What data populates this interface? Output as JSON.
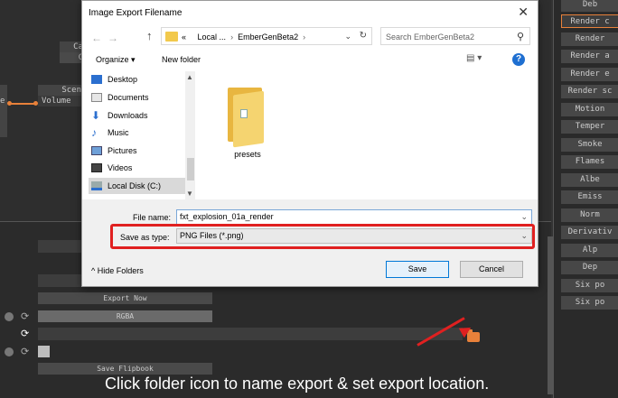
{
  "background": {
    "nodes": [
      {
        "title": "Ca",
        "body": "C"
      },
      {
        "title": "Scen",
        "body": "Volume"
      }
    ],
    "left_cut_text": "e",
    "export_now_label": "Export Now",
    "format_label": "RGBA",
    "save_flipbook_label": "Save Flipbook",
    "right_panel": [
      "Deb",
      "Render c",
      "Render",
      "Render a",
      "Render e",
      "Render sc",
      "Motion",
      "Temper",
      "Smoke",
      "Flames",
      "Albe",
      "Emiss",
      "Norm",
      "Derivativ",
      "Alp",
      "Dep",
      "Six po",
      "Six po"
    ],
    "active_right_item": 1,
    "accent_color": "#e8813a"
  },
  "dialog": {
    "title": "Image Export Filename",
    "breadcrumb": [
      "«",
      "Local ...",
      "EmberGenBeta2"
    ],
    "search_placeholder": "Search EmberGenBeta2",
    "organize_label": "Organize ▾",
    "new_folder_label": "New folder",
    "help_label": "?",
    "nav_items": [
      {
        "label": "Desktop",
        "icon": "desktop-icon"
      },
      {
        "label": "Documents",
        "icon": "documents-icon"
      },
      {
        "label": "Downloads",
        "icon": "downloads-icon"
      },
      {
        "label": "Music",
        "icon": "music-icon"
      },
      {
        "label": "Pictures",
        "icon": "pictures-icon"
      },
      {
        "label": "Videos",
        "icon": "videos-icon"
      },
      {
        "label": "Local Disk (C:)",
        "icon": "disk-icon"
      }
    ],
    "files": [
      {
        "name": "presets",
        "icon": "folder-icon"
      }
    ],
    "file_name_label": "File name:",
    "file_name_value": "fxt_explosion_01a_render",
    "save_type_label": "Save as type:",
    "save_type_value": "PNG Files (*.png)",
    "hide_folders_label": "Hide Folders",
    "save_label": "Save",
    "cancel_label": "Cancel",
    "highlight_color": "#e02020"
  },
  "caption": "Click folder icon to name export & set export location."
}
